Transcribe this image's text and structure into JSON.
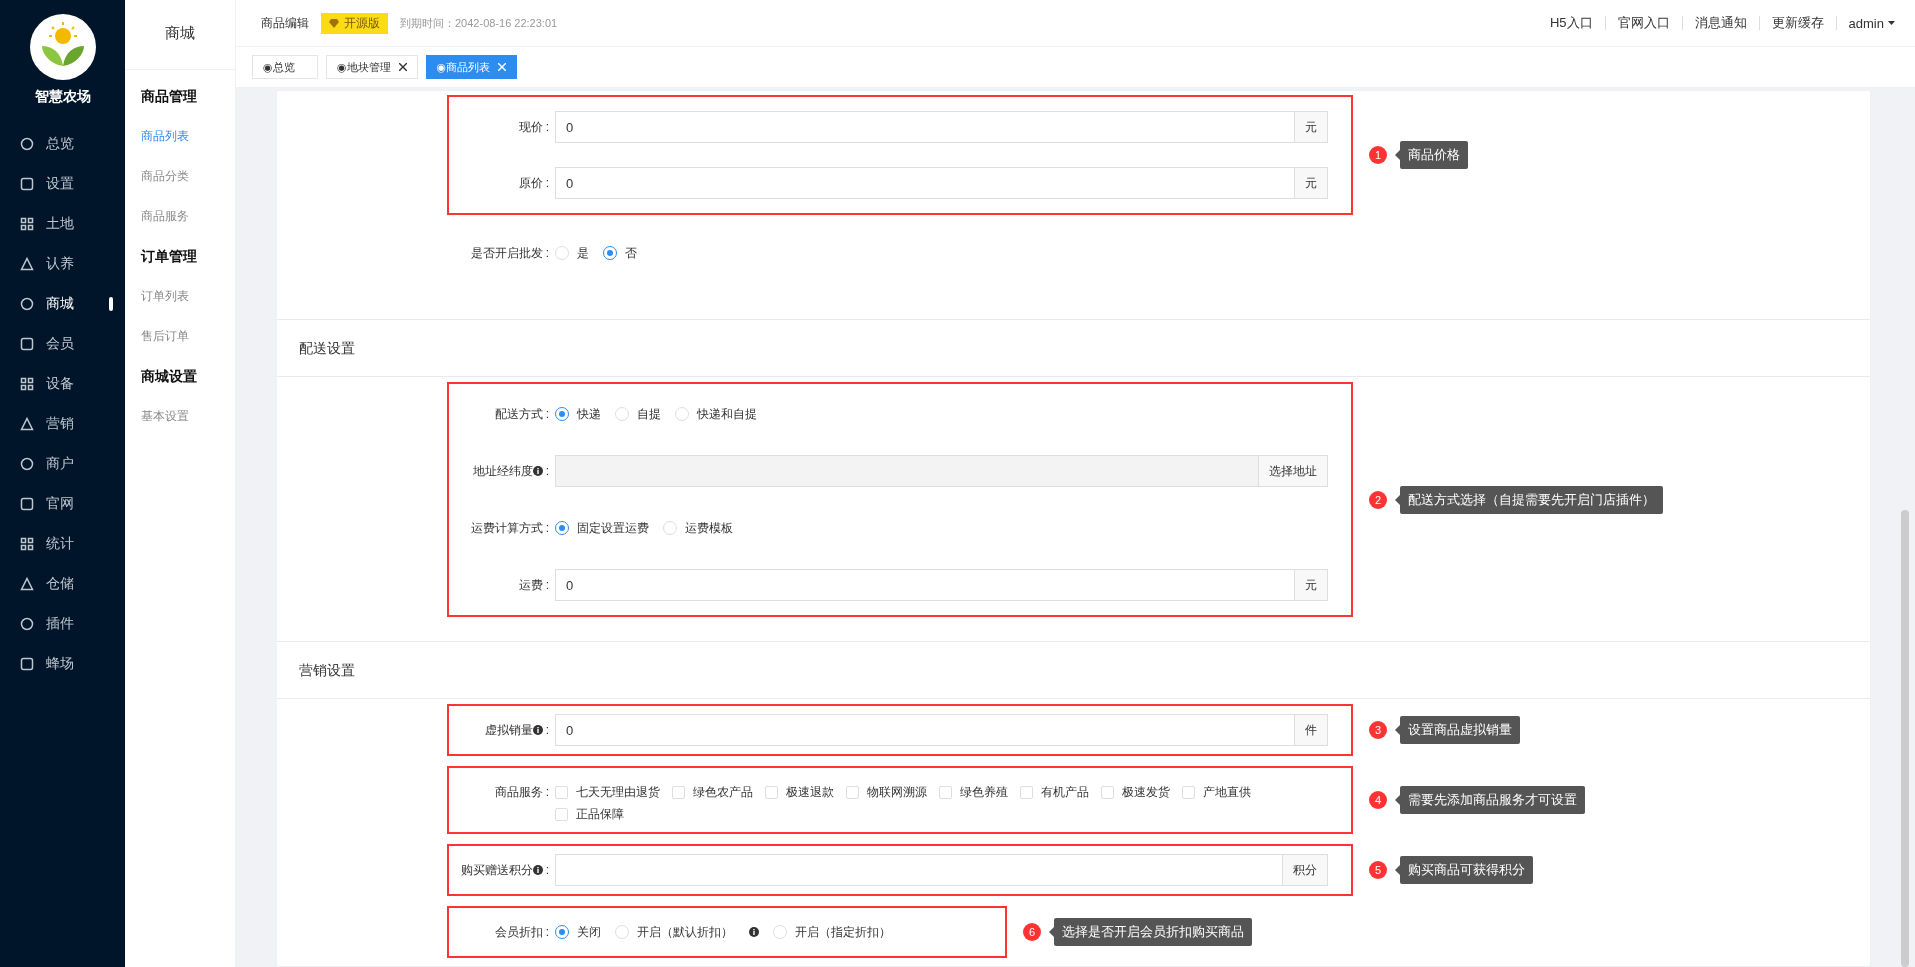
{
  "sidebar": {
    "logo_text": "智慧农场",
    "items": [
      {
        "label": "总览",
        "selected": false
      },
      {
        "label": "设置",
        "selected": false
      },
      {
        "label": "土地",
        "selected": false
      },
      {
        "label": "认养",
        "selected": false
      },
      {
        "label": "商城",
        "selected": true
      },
      {
        "label": "会员",
        "selected": false
      },
      {
        "label": "设备",
        "selected": false
      },
      {
        "label": "营销",
        "selected": false
      },
      {
        "label": "商户",
        "selected": false
      },
      {
        "label": "官网",
        "selected": false
      },
      {
        "label": "统计",
        "selected": false
      },
      {
        "label": "仓储",
        "selected": false
      },
      {
        "label": "插件",
        "selected": false
      },
      {
        "label": "蜂场",
        "selected": false
      }
    ]
  },
  "submenu": {
    "title": "商城",
    "groups": [
      {
        "heading": "商品管理",
        "items": [
          {
            "label": "商品列表",
            "selected": true
          },
          {
            "label": "商品分类",
            "selected": false
          },
          {
            "label": "商品服务",
            "selected": false
          }
        ]
      },
      {
        "heading": "订单管理",
        "items": [
          {
            "label": "订单列表",
            "selected": false
          },
          {
            "label": "售后订单",
            "selected": false
          }
        ]
      },
      {
        "heading": "商城设置",
        "items": [
          {
            "label": "基本设置",
            "selected": false
          }
        ]
      }
    ]
  },
  "header": {
    "page_title": "商品编辑",
    "edition_badge": "开源版",
    "expiry": "到期时间：2042-08-16 22:23:01",
    "links": [
      "H5入口",
      "官网入口",
      "消息通知",
      "更新缓存"
    ],
    "user": "admin"
  },
  "tabs": [
    {
      "label": "◉总览",
      "selected": false,
      "closable": false
    },
    {
      "label": "◉地块管理",
      "selected": false,
      "closable": true
    },
    {
      "label": "◉商品列表",
      "selected": true,
      "closable": true
    }
  ],
  "sections": [
    {
      "groups": [
        {
          "highlighted": true,
          "annotation": {
            "number": "1",
            "text": "商品价格"
          },
          "rows": [
            {
              "kind": "input",
              "label": "现价",
              "colon": ":",
              "value": "0",
              "addon": "元",
              "disabled": false
            },
            {
              "kind": "input",
              "label": "原价",
              "colon": ":",
              "value": "0",
              "addon": "元",
              "disabled": false
            }
          ]
        },
        {
          "rows": [
            {
              "kind": "radio",
              "label": "是否开启批发",
              "colon": ":",
              "options": [
                {
                  "label": "是",
                  "selected": false
                },
                {
                  "label": "否",
                  "selected": true
                }
              ]
            }
          ]
        }
      ]
    },
    {
      "title": "配送设置",
      "groups": [
        {
          "highlighted": true,
          "annotation": {
            "number": "2",
            "text": "配送方式选择（自提需要先开启门店插件）"
          },
          "rows": [
            {
              "kind": "radio",
              "label": "配送方式",
              "colon": ":",
              "options": [
                {
                  "label": "快递",
                  "selected": true
                },
                {
                  "label": "自提",
                  "selected": false
                },
                {
                  "label": "快递和自提",
                  "selected": false
                }
              ]
            },
            {
              "kind": "input",
              "label": "地址经纬度",
              "colon": ":",
              "info": true,
              "addon": "选择地址",
              "disabled": true
            },
            {
              "kind": "radio",
              "label": "运费计算方式",
              "colon": ":",
              "options": [
                {
                  "label": "固定设置运费",
                  "selected": true
                },
                {
                  "label": "运费模板",
                  "selected": false
                }
              ]
            },
            {
              "kind": "input",
              "label": "运费",
              "colon": ":",
              "value": "0",
              "addon": "元",
              "disabled": false
            }
          ]
        }
      ]
    },
    {
      "title": "营销设置",
      "groups": [
        {
          "highlighted": true,
          "annotation": {
            "number": "3",
            "text": "设置商品虚拟销量"
          },
          "rows": [
            {
              "kind": "input",
              "label": "虚拟销量",
              "colon": ":",
              "info": true,
              "value": "0",
              "addon": "件",
              "disabled": false
            }
          ]
        },
        {
          "highlighted": true,
          "annotation": {
            "number": "4",
            "text": "需要先添加商品服务才可设置"
          },
          "rows": [
            {
              "kind": "checkbox",
              "label": "商品服务",
              "colon": ":",
              "options": [
                {
                  "label": "七天无理由退货",
                  "checked": false
                },
                {
                  "label": "绿色农产品",
                  "checked": false
                },
                {
                  "label": "极速退款",
                  "checked": false
                },
                {
                  "label": "物联网溯源",
                  "checked": false
                },
                {
                  "label": "绿色养殖",
                  "checked": false
                },
                {
                  "label": "有机产品",
                  "checked": false
                },
                {
                  "label": "极速发货",
                  "checked": false
                },
                {
                  "label": "产地直供",
                  "checked": false
                },
                {
                  "label": "正品保障",
                  "checked": false
                }
              ]
            }
          ]
        },
        {
          "highlighted": true,
          "annotation": {
            "number": "5",
            "text": "购买商品可获得积分"
          },
          "rows": [
            {
              "kind": "input",
              "label": "购买赠送积分",
              "colon": ":",
              "info": true,
              "addon": "积分",
              "disabled": false
            }
          ]
        },
        {
          "highlighted": true,
          "annotation": {
            "number": "6",
            "text": "选择是否开启会员折扣购买商品"
          },
          "rows": [
            {
              "kind": "radio",
              "label": "会员折扣",
              "colon": ":",
              "options": [
                {
                  "label": "关闭",
                  "selected": true
                },
                {
                  "label": "开启（默认折扣）",
                  "selected": false,
                  "info": true
                },
                {
                  "label": "开启（指定折扣）",
                  "selected": false
                }
              ]
            }
          ]
        }
      ]
    }
  ]
}
